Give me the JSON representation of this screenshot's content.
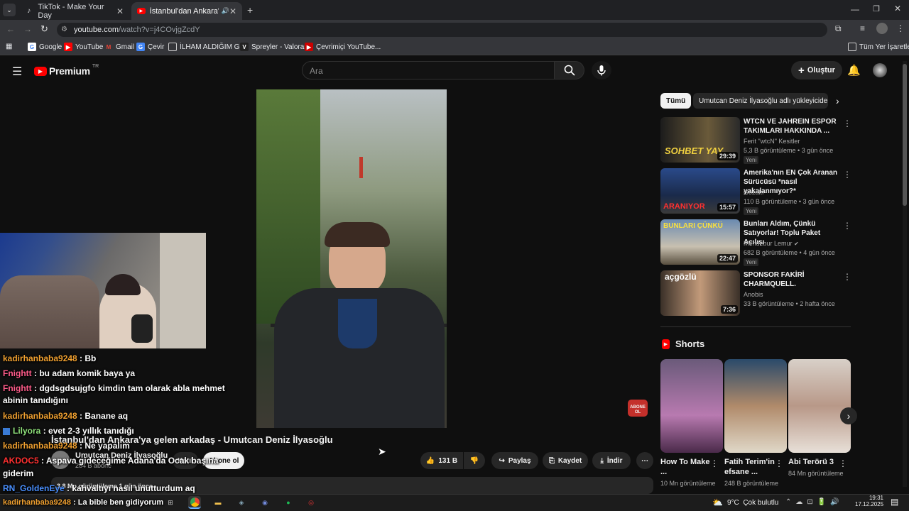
{
  "browser": {
    "tabs": [
      {
        "title": "TikTok - Make Your Day"
      },
      {
        "title": "İstanbul'dan Ankara'ya gele"
      }
    ],
    "url_host": "youtube.com",
    "url_path": "/watch?v=j4COvjgZcdY",
    "bookmarks": [
      "Google",
      "YouTube",
      "Gmail",
      "Çevir",
      "İLHAM ALDIĞIM G...",
      "Spreyler - Valorant",
      "Çevrimiçi YouTube..."
    ],
    "all_bookmarks": "Tüm Yer İşaretleri"
  },
  "youtube": {
    "logo": "Premium",
    "logo_sup": "TR",
    "search_placeholder": "Ara",
    "create_label": "Oluştur",
    "chips": [
      "Tümü",
      "Umutcan Deniz İlyasoğlu adlı yükleyiciden"
    ],
    "video": {
      "title": "İstanbul'dan Ankara'ya gelen arkadaş - Umutcan Deniz İlyasoğlu",
      "channel": "Umutcan Deniz İlyasoğlu",
      "subs": "284 B abone",
      "join": "Katıl",
      "subscribe": "Abone ol",
      "likes": "131 B",
      "share": "Paylaş",
      "save": "Kaydet",
      "download": "İndir",
      "views_line": "3,8 Mn görüntüleme  1 gün önce",
      "watermark": "ABONE OL"
    },
    "recommendations": [
      {
        "title": "WTCN VE JAHREIN ESPOR TAKIMLARI HAKKINDA ...",
        "channel": "Ferit \"wtcN\" Kesitler",
        "meta": "5,3 B görüntüleme • 3 gün önce",
        "badge": "Yeni",
        "duration": "29:39",
        "thumb_text": "SOHBET YAY"
      },
      {
        "title": "Amerika'nın EN Çok Aranan Sürücüsü *nasıl yakalanmıyor?*",
        "channel": "Gözaltı",
        "meta": "110 B görüntüleme • 3 gün önce",
        "badge": "Yeni",
        "duration": "15:57",
        "thumb_text": "ARANIYOR"
      },
      {
        "title": "Bunları Aldım, Çünkü Satıyorlar! Toplu Paket Açılışı",
        "channel": "Mendebur Lemur",
        "meta": "682 B görüntüleme • 4 gün önce",
        "badge": "Yeni",
        "duration": "22:47",
        "thumb_text": "BUNLARI ÇÜNKÜ"
      },
      {
        "title": "SPONSOR FAKİRİ CHARMQUELL.",
        "channel": "Anobis",
        "meta": "33 B görüntüleme • 2 hafta önce",
        "badge": "",
        "duration": "7:36",
        "thumb_text": "açgözlü"
      }
    ],
    "shorts_title": "Shorts",
    "shorts": [
      {
        "title": "How To Make ...",
        "views": "10 Mn görüntüleme"
      },
      {
        "title": "Fatih Terim'in efsane ...",
        "views": "248 B görüntüleme"
      },
      {
        "title": "Abi Terörü 3",
        "views": "84 Mn görüntüleme"
      }
    ]
  },
  "chat": [
    {
      "user": "kadirhanbaba9248",
      "text": " : Bb",
      "color": "#f0a030"
    },
    {
      "user": "Fnightt",
      "text": " : bu adam komik baya ya",
      "color": "#ff5c8a"
    },
    {
      "user": "Fnightt",
      "text": " : dgdsgdsujgfo kimdin tam olarak abla mehmet",
      "color": "#ff5c8a"
    },
    {
      "user": "",
      "text": "abinin tanıdığını",
      "color": "#ffffff"
    },
    {
      "user": "kadirhanbaba9248",
      "text": " : Banane aq",
      "color": "#f0a030"
    },
    {
      "user": "Lilyora",
      "text": " : evet 2-3 yıllık tanıdığı",
      "color": "#8ee07a"
    },
    {
      "user": "kadirhanbaba9248",
      "text": " : Ne yapalım",
      "color": "#f0a030"
    },
    {
      "user": "AKDOC5",
      "text": " : Aspava gideceğime Adana'da Ocak başına",
      "color": "#ff3030"
    },
    {
      "user": "",
      "text": "giderim",
      "color": "#ffffff"
    },
    {
      "user": "RN_GoldenEye",
      "text": " : kahvaltıyı nasıl unutturdum aq",
      "color": "#4a90ff"
    },
    {
      "user": "kadirhanbaba9248",
      "text": " : La bible ben gidiyorum",
      "color": "#f0a030"
    }
  ],
  "taskbar": {
    "weather": "9°C  Çok bulutlu",
    "time": "19:31",
    "date": "17.12.2025"
  }
}
